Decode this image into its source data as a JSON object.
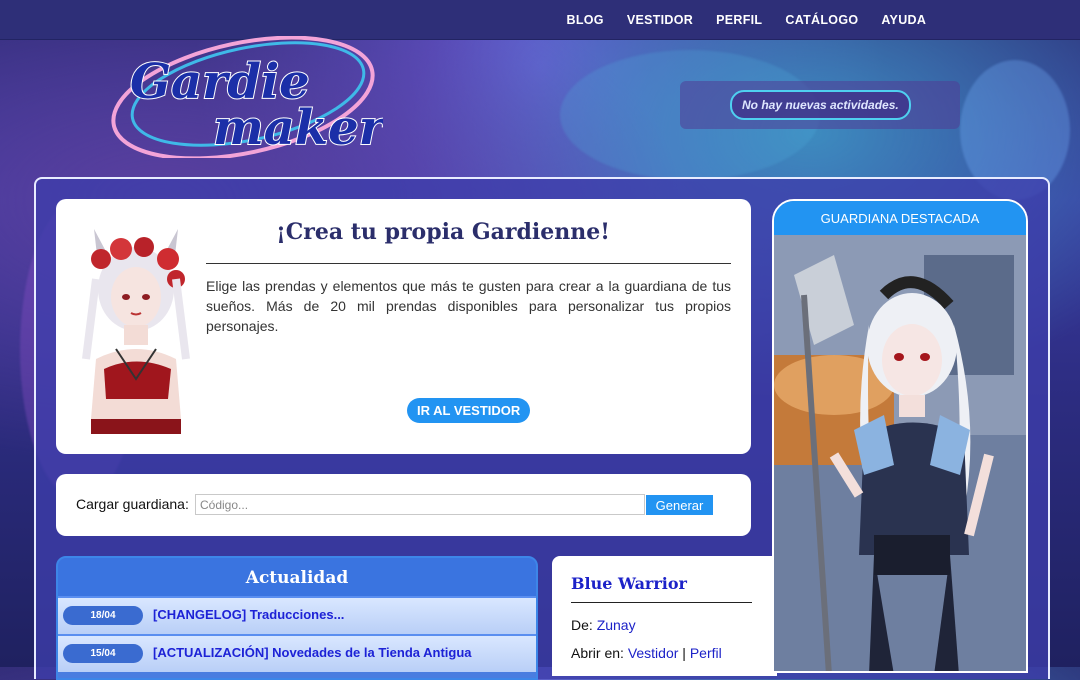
{
  "nav": {
    "items": [
      "BLOG",
      "VESTIDOR",
      "PERFIL",
      "CATÁLOGO",
      "AYUDA"
    ]
  },
  "logo": {
    "line1": "Gardie",
    "line2": "maker"
  },
  "activity": {
    "text": "No hay nuevas actividades."
  },
  "hero": {
    "title": "¡Crea tu propia Gardienne!",
    "text": "Elige las prendas y elementos que más te gusten para crear a la guardiana de tus sueños. Más de 20 mil prendas disponibles para personalizar tus propios personajes.",
    "button": "IR AL VESTIDOR"
  },
  "load": {
    "label": "Cargar guardiana:",
    "placeholder": "Código...",
    "button": "Generar"
  },
  "news": {
    "title": "Actualidad",
    "items": [
      {
        "date": "18/04",
        "title": "[CHANGELOG] Traducciones..."
      },
      {
        "date": "15/04",
        "title": "[ACTUALIZACIÓN] Novedades de la Tienda Antigua"
      }
    ]
  },
  "featured_outfit": {
    "name": "Blue Warrior",
    "by_label": "De:",
    "author": "Zunay",
    "open_label": "Abrir en:",
    "open_vestidor": "Vestidor",
    "separator": "|",
    "open_perfil": "Perfil"
  },
  "featured": {
    "header": "GUARDIANA DESTACADA"
  },
  "colors": {
    "accent": "#2294f2",
    "link": "#1c22c8",
    "nav_bg": "#2e2f78"
  }
}
